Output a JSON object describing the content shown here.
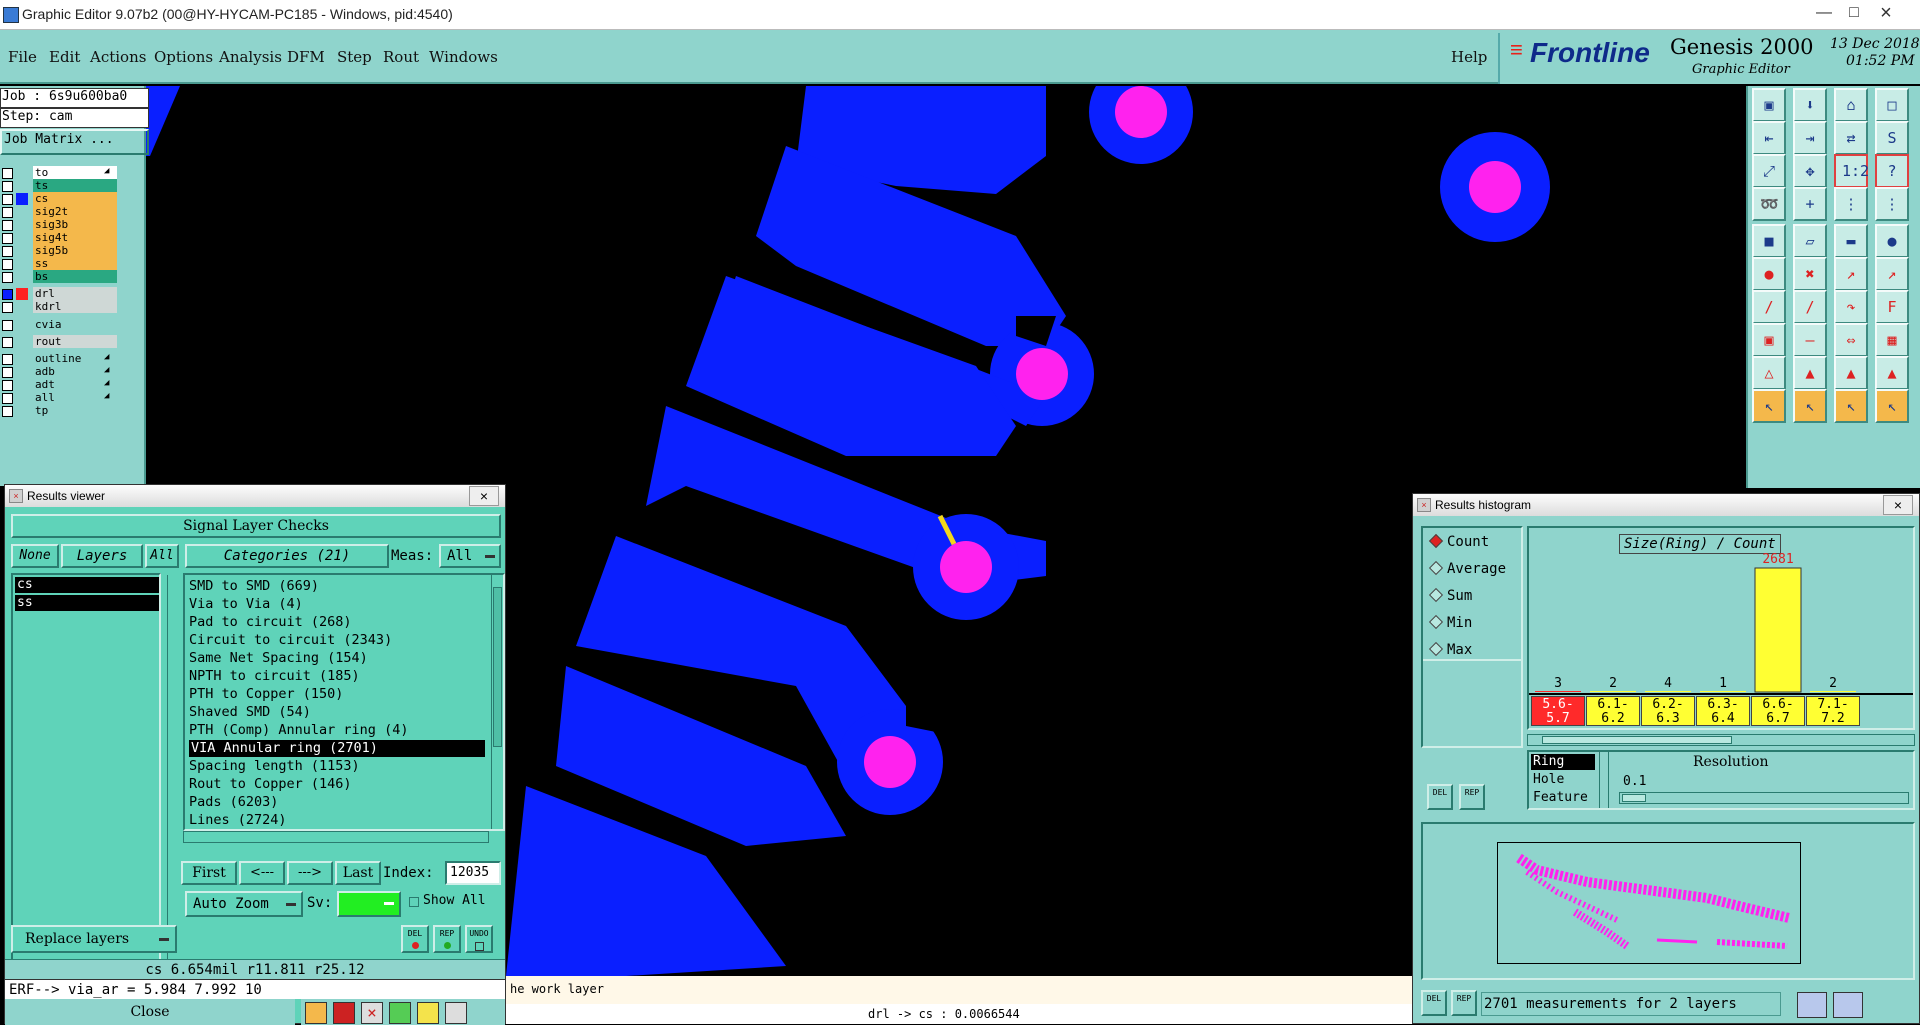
{
  "window": {
    "title": "Graphic Editor 9.07b2 (00@HY-HYCAM-PC185 - Windows, pid:4540)"
  },
  "menu": [
    "File",
    "Edit",
    "Actions",
    "Options",
    "Analysis",
    "DFM",
    "Step",
    "Rout",
    "Windows"
  ],
  "help_label": "Help",
  "brand": {
    "logo": "Frontline",
    "product": "Genesis 2000",
    "subtitle": "Graphic Editor",
    "date": "13 Dec 2018",
    "time": "01:52 PM"
  },
  "job": {
    "job_label": "Job : 6s9u600ba0",
    "step_label": "Step: cam",
    "matrix_button": "Job Matrix ..."
  },
  "layers": [
    {
      "name": "to",
      "color": "#ffffff",
      "mark": "●"
    },
    {
      "name": "ts",
      "color": "#2aa882",
      "mark": ""
    },
    {
      "name": "cs",
      "color": "#f4b84b",
      "mark": ""
    },
    {
      "name": "sig2t",
      "color": "#f4b84b",
      "mark": ""
    },
    {
      "name": "sig3b",
      "color": "#f4b84b",
      "mark": ""
    },
    {
      "name": "sig4t",
      "color": "#f4b84b",
      "mark": ""
    },
    {
      "name": "sig5b",
      "color": "#f4b84b",
      "mark": ""
    },
    {
      "name": "ss",
      "color": "#f4b84b",
      "mark": ""
    },
    {
      "name": "bs",
      "color": "#2aa882",
      "mark": ""
    },
    {
      "name": "drl",
      "color": "#cfd8d6",
      "mark": ""
    },
    {
      "name": "kdrl",
      "color": "#cfd8d6",
      "mark": ""
    },
    {
      "name": "cvia",
      "color": "#8fd4cc",
      "mark": ""
    },
    {
      "name": "rout",
      "color": "#cfd8d6",
      "mark": ""
    },
    {
      "name": "outline",
      "color": "#8fd4cc",
      "mark": "●"
    },
    {
      "name": "adb",
      "color": "#8fd4cc",
      "mark": "●"
    },
    {
      "name": "adt",
      "color": "#8fd4cc",
      "mark": "●"
    },
    {
      "name": "all",
      "color": "#8fd4cc",
      "mark": "●"
    },
    {
      "name": "tp",
      "color": "#8fd4cc",
      "mark": ""
    }
  ],
  "results_viewer": {
    "title": "Results viewer",
    "header": "Signal Layer Checks",
    "none_btn": "None",
    "layers_btn": "Layers",
    "all_btn": "All",
    "categories_label": "Categories (21)",
    "meas_label": "Meas:",
    "meas_value": "All",
    "selected_layers": [
      "cs",
      "ss"
    ],
    "categories": [
      "SMD to SMD (669)",
      "Via to Via (4)",
      "Pad to circuit (268)",
      "Circuit to circuit (2343)",
      "Same Net Spacing (154)",
      "NPTH to circuit (185)",
      "PTH to Copper (150)",
      "Shaved SMD (54)",
      "PTH (Comp) Annular ring (4)",
      "VIA Annular ring (2701)",
      "Spacing length (1153)",
      "Rout to Copper (146)",
      "Pads (6203)",
      "Lines (2724)"
    ],
    "selected_category": "VIA Annular ring (2701)",
    "nav": {
      "first": "First",
      "prev": "<---",
      "next": "--->",
      "last": "Last",
      "index_label": "Index:",
      "index_value": "12035"
    },
    "auto_zoom": "Auto Zoom",
    "sv_label": "Sv:",
    "show_all": "Show All",
    "replace_layers": "Replace layers",
    "small_btns": [
      "DEL",
      "REP",
      "UNDO"
    ],
    "measure_line": "cs 6.654mil  r11.811  r25.12",
    "erf_line": "ERF--> via_ar = 5.984 7.992 10",
    "close_btn": "Close"
  },
  "histogram": {
    "title": "Results histogram",
    "modes": [
      "Count",
      "Average",
      "Sum",
      "Min",
      "Max"
    ],
    "selected_mode": "Count",
    "chart_title": "Size(Ring) / Count",
    "peak_label": "2681",
    "bins": [
      {
        "range": "5.6-\n5.7",
        "count": "3",
        "color": "#ff2a2a",
        "value": 3
      },
      {
        "range": "6.1-\n6.2",
        "count": "2",
        "color": "#ffff33",
        "value": 2
      },
      {
        "range": "6.2-\n6.3",
        "count": "4",
        "color": "#ffff33",
        "value": 4
      },
      {
        "range": "6.3-\n6.4",
        "count": "1",
        "color": "#ffff33",
        "value": 1
      },
      {
        "range": "6.6-\n6.7",
        "count": "",
        "color": "#ffff33",
        "value": 2681
      },
      {
        "range": "7.1-\n7.2",
        "count": "2",
        "color": "#ffff33",
        "value": 2
      }
    ],
    "options": [
      "Ring",
      "Hole",
      "Feature"
    ],
    "selected_option": "Ring",
    "resolution_label": "Resolution",
    "resolution_value": "0.1",
    "small_btns": [
      "DEL",
      "REP"
    ],
    "summary": "2701 measurements for 2 layers"
  },
  "status": {
    "message": "he work layer",
    "bottom": "drl  -> cs : 0.0066544"
  },
  "chart_data": {
    "type": "bar",
    "title": "Size(Ring) / Count",
    "categories": [
      "5.6-5.7",
      "6.1-6.2",
      "6.2-6.3",
      "6.3-6.4",
      "6.6-6.7",
      "7.1-7.2"
    ],
    "values": [
      3,
      2,
      4,
      1,
      2681,
      2
    ]
  }
}
